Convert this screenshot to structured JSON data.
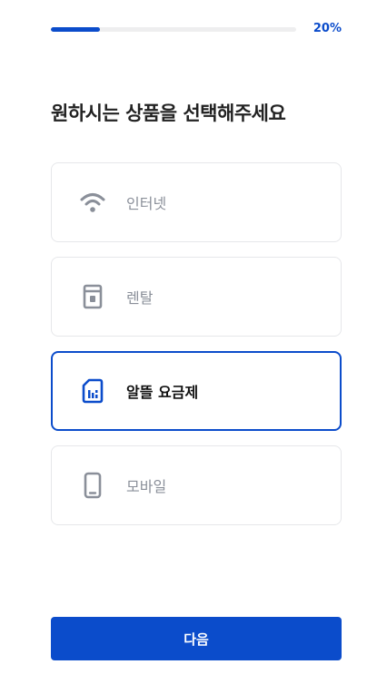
{
  "progress": {
    "value": 0.2,
    "label": "20%"
  },
  "title": "원하시는 상품을 선택해주세요",
  "options": [
    {
      "label": "인터넷",
      "icon": "wifi-icon",
      "selected": false
    },
    {
      "label": "렌탈",
      "icon": "water-purifier-icon",
      "selected": false
    },
    {
      "label": "알뜰 요금제",
      "icon": "sim-card-icon",
      "selected": true
    },
    {
      "label": "모바일",
      "icon": "smartphone-icon",
      "selected": false
    }
  ],
  "next_button": {
    "label": "다음"
  },
  "colors": {
    "accent": "#0b4ccb",
    "muted_icon": "#8a8f99",
    "border": "#e6e7ea",
    "track": "#eeeeef"
  }
}
